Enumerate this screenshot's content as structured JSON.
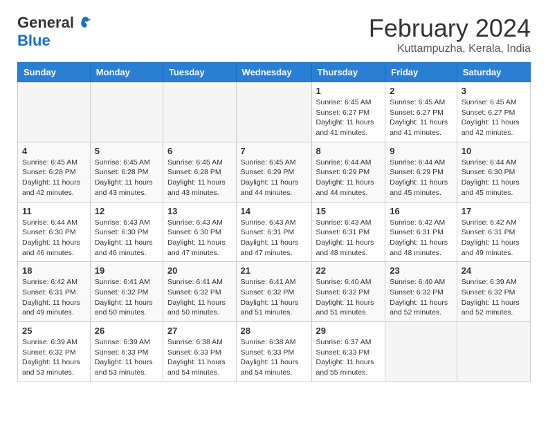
{
  "header": {
    "logo_general": "General",
    "logo_blue": "Blue",
    "month_title": "February 2024",
    "subtitle": "Kuttampuzha, Kerala, India"
  },
  "columns": [
    "Sunday",
    "Monday",
    "Tuesday",
    "Wednesday",
    "Thursday",
    "Friday",
    "Saturday"
  ],
  "weeks": [
    [
      {
        "day": "",
        "info": ""
      },
      {
        "day": "",
        "info": ""
      },
      {
        "day": "",
        "info": ""
      },
      {
        "day": "",
        "info": ""
      },
      {
        "day": "1",
        "info": "Sunrise: 6:45 AM\nSunset: 6:27 PM\nDaylight: 11 hours\nand 41 minutes."
      },
      {
        "day": "2",
        "info": "Sunrise: 6:45 AM\nSunset: 6:27 PM\nDaylight: 11 hours\nand 41 minutes."
      },
      {
        "day": "3",
        "info": "Sunrise: 6:45 AM\nSunset: 6:27 PM\nDaylight: 11 hours\nand 42 minutes."
      }
    ],
    [
      {
        "day": "4",
        "info": "Sunrise: 6:45 AM\nSunset: 6:28 PM\nDaylight: 11 hours\nand 42 minutes."
      },
      {
        "day": "5",
        "info": "Sunrise: 6:45 AM\nSunset: 6:28 PM\nDaylight: 11 hours\nand 43 minutes."
      },
      {
        "day": "6",
        "info": "Sunrise: 6:45 AM\nSunset: 6:28 PM\nDaylight: 11 hours\nand 43 minutes."
      },
      {
        "day": "7",
        "info": "Sunrise: 6:45 AM\nSunset: 6:29 PM\nDaylight: 11 hours\nand 44 minutes."
      },
      {
        "day": "8",
        "info": "Sunrise: 6:44 AM\nSunset: 6:29 PM\nDaylight: 11 hours\nand 44 minutes."
      },
      {
        "day": "9",
        "info": "Sunrise: 6:44 AM\nSunset: 6:29 PM\nDaylight: 11 hours\nand 45 minutes."
      },
      {
        "day": "10",
        "info": "Sunrise: 6:44 AM\nSunset: 6:30 PM\nDaylight: 11 hours\nand 45 minutes."
      }
    ],
    [
      {
        "day": "11",
        "info": "Sunrise: 6:44 AM\nSunset: 6:30 PM\nDaylight: 11 hours\nand 46 minutes."
      },
      {
        "day": "12",
        "info": "Sunrise: 6:43 AM\nSunset: 6:30 PM\nDaylight: 11 hours\nand 46 minutes."
      },
      {
        "day": "13",
        "info": "Sunrise: 6:43 AM\nSunset: 6:30 PM\nDaylight: 11 hours\nand 47 minutes."
      },
      {
        "day": "14",
        "info": "Sunrise: 6:43 AM\nSunset: 6:31 PM\nDaylight: 11 hours\nand 47 minutes."
      },
      {
        "day": "15",
        "info": "Sunrise: 6:43 AM\nSunset: 6:31 PM\nDaylight: 11 hours\nand 48 minutes."
      },
      {
        "day": "16",
        "info": "Sunrise: 6:42 AM\nSunset: 6:31 PM\nDaylight: 11 hours\nand 48 minutes."
      },
      {
        "day": "17",
        "info": "Sunrise: 6:42 AM\nSunset: 6:31 PM\nDaylight: 11 hours\nand 49 minutes."
      }
    ],
    [
      {
        "day": "18",
        "info": "Sunrise: 6:42 AM\nSunset: 6:31 PM\nDaylight: 11 hours\nand 49 minutes."
      },
      {
        "day": "19",
        "info": "Sunrise: 6:41 AM\nSunset: 6:32 PM\nDaylight: 11 hours\nand 50 minutes."
      },
      {
        "day": "20",
        "info": "Sunrise: 6:41 AM\nSunset: 6:32 PM\nDaylight: 11 hours\nand 50 minutes."
      },
      {
        "day": "21",
        "info": "Sunrise: 6:41 AM\nSunset: 6:32 PM\nDaylight: 11 hours\nand 51 minutes."
      },
      {
        "day": "22",
        "info": "Sunrise: 6:40 AM\nSunset: 6:32 PM\nDaylight: 11 hours\nand 51 minutes."
      },
      {
        "day": "23",
        "info": "Sunrise: 6:40 AM\nSunset: 6:32 PM\nDaylight: 11 hours\nand 52 minutes."
      },
      {
        "day": "24",
        "info": "Sunrise: 6:39 AM\nSunset: 6:32 PM\nDaylight: 11 hours\nand 52 minutes."
      }
    ],
    [
      {
        "day": "25",
        "info": "Sunrise: 6:39 AM\nSunset: 6:32 PM\nDaylight: 11 hours\nand 53 minutes."
      },
      {
        "day": "26",
        "info": "Sunrise: 6:39 AM\nSunset: 6:33 PM\nDaylight: 11 hours\nand 53 minutes."
      },
      {
        "day": "27",
        "info": "Sunrise: 6:38 AM\nSunset: 6:33 PM\nDaylight: 11 hours\nand 54 minutes."
      },
      {
        "day": "28",
        "info": "Sunrise: 6:38 AM\nSunset: 6:33 PM\nDaylight: 11 hours\nand 54 minutes."
      },
      {
        "day": "29",
        "info": "Sunrise: 6:37 AM\nSunset: 6:33 PM\nDaylight: 11 hours\nand 55 minutes."
      },
      {
        "day": "",
        "info": ""
      },
      {
        "day": "",
        "info": ""
      }
    ]
  ]
}
